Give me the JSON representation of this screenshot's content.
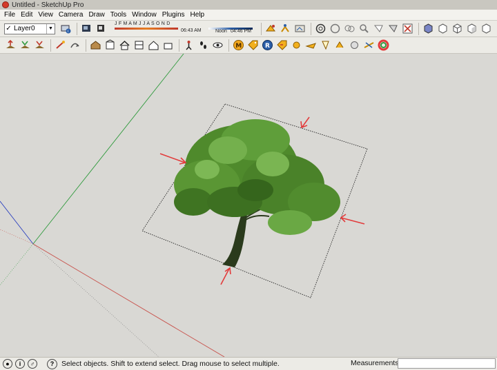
{
  "window": {
    "title": "Untitled - SketchUp Pro",
    "app_icon": "sketchup-icon"
  },
  "menu": [
    "File",
    "Edit",
    "View",
    "Camera",
    "Draw",
    "Tools",
    "Window",
    "Plugins",
    "Help"
  ],
  "layer": {
    "selected": "Layer0"
  },
  "shadows": {
    "months": "J F M A M J J A S O N D",
    "time_start": "06:43 AM",
    "noon_label": "Noon",
    "time_end": "04:46 PM"
  },
  "status": {
    "message": "Select objects. Shift to extend select. Drag mouse to select multiple.",
    "measurements_label": "Measurements",
    "measurements_value": ""
  },
  "colors": {
    "axis_red": "#c8504a",
    "axis_green": "#2e9a3c",
    "axis_blue": "#2a3fbf",
    "arrow_red": "#e23b3b",
    "tree_foliage": "#4f8a2c",
    "tree_trunk": "#2a3a1c",
    "background": "#d9d8d4"
  }
}
